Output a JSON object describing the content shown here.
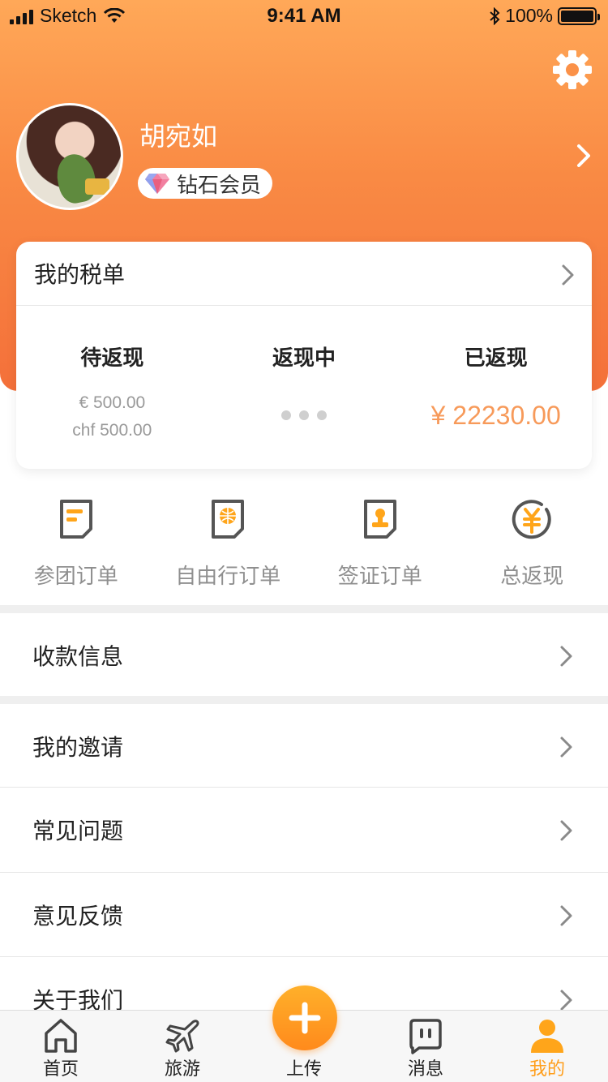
{
  "status_bar": {
    "carrier": "Sketch",
    "time": "9:41 AM",
    "battery": "100%"
  },
  "profile": {
    "name": "胡宛如",
    "member_level": "钻石会员"
  },
  "tax_card": {
    "title": "我的税单",
    "columns": [
      {
        "title": "待返现",
        "amounts": [
          "€ 500.00",
          "chf 500.00"
        ]
      },
      {
        "title": "返现中"
      },
      {
        "title": "已返现",
        "amount": "¥ 22230.00"
      }
    ]
  },
  "orders": [
    {
      "label": "参团订单",
      "icon": "group-order-icon"
    },
    {
      "label": "自由行订单",
      "icon": "free-travel-order-icon"
    },
    {
      "label": "签证订单",
      "icon": "visa-order-icon"
    },
    {
      "label": "总返现",
      "icon": "total-cashback-icon"
    }
  ],
  "menu": {
    "payment_info": "收款信息",
    "invites": "我的邀请",
    "faq": "常见问题",
    "feedback": "意见反馈",
    "about": "关于我们"
  },
  "tab_bar": {
    "home": "首页",
    "travel": "旅游",
    "upload": "上传",
    "messages": "消息",
    "mine": "我的"
  },
  "colors": {
    "accent": "#ff9e1b",
    "header_gradient_top": "#ffa858",
    "header_gradient_bottom": "#f4703a",
    "cashback_amount": "#f79a5a"
  }
}
